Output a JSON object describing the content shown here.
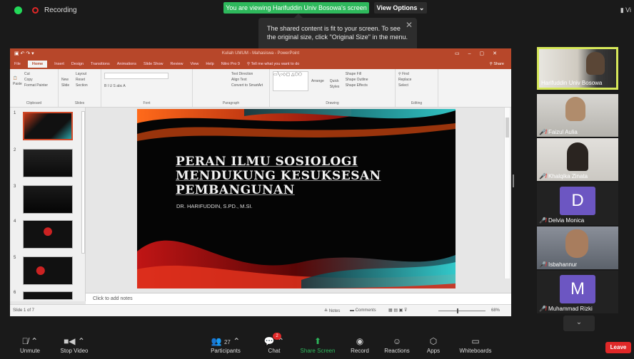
{
  "zoom": {
    "recording_label": "Recording",
    "viewing_banner": "You are viewing Harifuddin Univ Bosowa's screen",
    "view_options": "View Options",
    "tooltip_text": "The shared content is fit to your screen. To see the original size, click \"Original Size\" in the menu.",
    "top_right_label": "Vi",
    "toolbar": {
      "unmute": "Unmute",
      "stop_video": "Stop Video",
      "participants": "Participants",
      "participants_count": "27",
      "chat": "Chat",
      "chat_badge": "2",
      "share_screen": "Share Screen",
      "record": "Record",
      "reactions": "Reactions",
      "apps": "Apps",
      "whiteboards": "Whiteboards",
      "leave": "Leave"
    },
    "participants": [
      {
        "name": "Harifuddin Univ Bosowa",
        "active": true
      },
      {
        "name": "Faizul Aulia",
        "muted": true
      },
      {
        "name": "Khalqika Zinata",
        "muted": true
      },
      {
        "name": "Delvia Monica",
        "muted": true,
        "initial": "D"
      },
      {
        "name": "Isbahannur",
        "muted": true
      },
      {
        "name": "Muhammad Rizki",
        "muted": true,
        "initial": "M"
      }
    ]
  },
  "ppt": {
    "window_title": "Kuliah UMUM - Mahasiswa - PowerPoint",
    "tabs": [
      "File",
      "Home",
      "Insert",
      "Design",
      "Transitions",
      "Animations",
      "Slide Show",
      "Review",
      "View",
      "Help",
      "Nitro Pro 9",
      "Tell me what you want to do"
    ],
    "share_tab": "Share",
    "ribbon_groups": [
      "Clipboard",
      "Slides",
      "Font",
      "Paragraph",
      "Drawing",
      "Editing"
    ],
    "clipboard": {
      "paste": "Paste",
      "cut": "Cut",
      "copy": "Copy",
      "format_painter": "Format Painter"
    },
    "slides_group": {
      "new_slide": "New Slide",
      "layout": "Layout",
      "reset": "Reset",
      "section": "Section"
    },
    "paragraph_group": {
      "text_direction": "Text Direction",
      "align_text": "Align Text",
      "convert": "Convert to SmartArt"
    },
    "drawing_group": {
      "arrange": "Arrange",
      "quick_styles": "Quick Styles",
      "shape_fill": "Shape Fill",
      "shape_outline": "Shape Outline",
      "shape_effects": "Shape Effects"
    },
    "editing_group": {
      "find": "Find",
      "replace": "Replace",
      "select": "Select"
    },
    "slide_numbers": [
      "1",
      "2",
      "3",
      "4",
      "5",
      "6"
    ],
    "slide": {
      "title_line1": "PERAN ILMU SOSIOLOGI",
      "title_line2": "MENDUKUNG KESUKSESAN",
      "title_line3": "PEMBANGUNAN",
      "subtitle": "DR. HARIFUDDIN, S.PD., M.SI."
    },
    "notes_placeholder": "Click to add notes",
    "status": {
      "slide_count": "Slide 1 of 7",
      "notes": "Notes",
      "comments": "Comments",
      "zoom": "68%"
    }
  }
}
